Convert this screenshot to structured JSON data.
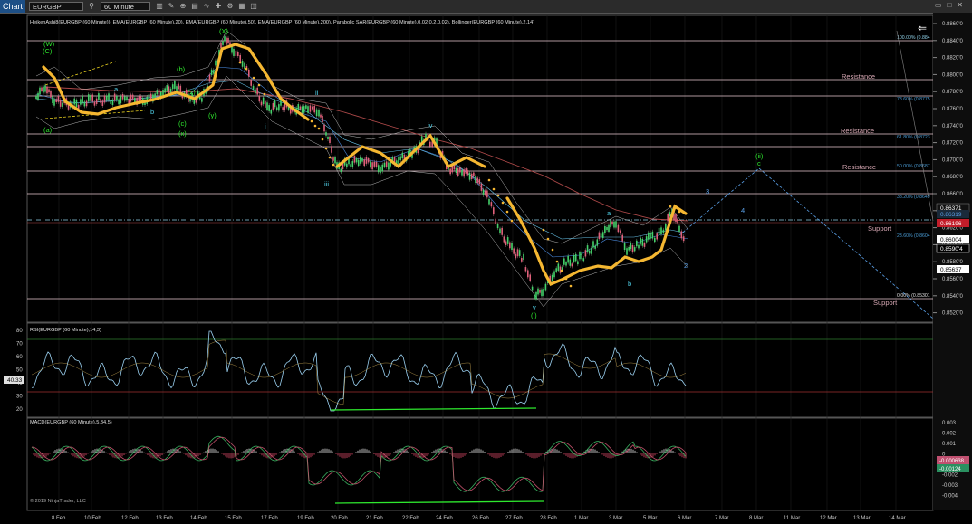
{
  "toolbar": {
    "chart_tab": "Chart",
    "instrument": "EURGBP",
    "interval": "60 Minute"
  },
  "panels": {
    "price_header": "HeikenAshi8(EURGBP (60 Minute)), EMA(EURGBP (60 Minute),20), EMA(EURGBP (60 Minute),50), EMA(EURGBP (60 Minute),200), Parabolic SAR(EURGBP (60 Minute),0.02,0.2,0.02), Bollinger(EURGBP (60 Minute),2,14)",
    "rsi_header": "RSI(EURGBP (60 Minute),14,3)",
    "macd_header": "MACD(EURGBP (60 Minute),5,34,5)",
    "copyright": "© 2019 NinjaTrader, LLC"
  },
  "price_axis": {
    "ticks": [
      "0.8860'0",
      "0.8840'0",
      "0.8820'0",
      "0.8800'0",
      "0.8780'0",
      "0.8760'0",
      "0.8740'0",
      "0.8720'0",
      "0.8700'0",
      "0.8680'0",
      "0.8660'0",
      "0.8640'0",
      "0.8620'0",
      "0.8600'0",
      "0.8580'0",
      "0.8560'0",
      "0.8540'0",
      "0.8520'0"
    ],
    "flags": {
      "last_price": "0.8590'4",
      "level_1": "0.86371",
      "level_2": "0.86319",
      "level_3": "0.86196",
      "level_4": "0.86004",
      "level_5": "0.85637"
    }
  },
  "rsi_axis": {
    "ticks": [
      "80",
      "70",
      "60",
      "50",
      "40",
      "30",
      "20"
    ],
    "current": "40.33"
  },
  "macd_axis": {
    "ticks": [
      "0.003",
      "0.002",
      "0.001",
      "0",
      "-0.001",
      "-0.002",
      "-0.003",
      "-0.004"
    ],
    "flag_1": "-0.000638",
    "flag_2": "-0.00124"
  },
  "x_axis": {
    "labels": [
      "8 Feb",
      "10 Feb",
      "12 Feb",
      "13 Feb",
      "14 Feb",
      "15 Feb",
      "17 Feb",
      "19 Feb",
      "20 Feb",
      "21 Feb",
      "22 Feb",
      "24 Feb",
      "26 Feb",
      "27 Feb",
      "28 Feb",
      "1 Mar",
      "3 Mar",
      "5 Mar",
      "6 Mar",
      "7 Mar",
      "8 Mar",
      "11 Mar",
      "12 Mar",
      "13 Mar",
      "14 Mar"
    ]
  },
  "annotations": {
    "resistance_1": "Resistance",
    "resistance_2": "Resistance",
    "resistance_3": "Resistance",
    "support_1": "Support",
    "support_2": "Support",
    "fib_100": "100.00% (0.884",
    "fib_786": "78.60% (0.8775",
    "fib_618": "61.80% (0.8723",
    "fib_50": "50.00% (0.8687",
    "fib_382": "38.20% (0.8649",
    "fib_236": "23.60% (0.8604",
    "fib_0": "0.00% (0.85301",
    "wave_W": "(W)",
    "wave_X_label": "(X)",
    "wave_ii": "(ii)",
    "wave_i": "(i)",
    "wave_c": "c",
    "wave_v": "v",
    "wave_iii": "iii",
    "wave_iv": "iv",
    "wave_a": "a",
    "wave_b": "b",
    "wave_3": "3",
    "wave_4": "4",
    "wave_2": "2",
    "wave_ii_small": "ii",
    "wave_i_small": "i",
    "wave_y": "(y)",
    "wave_z": "(z)",
    "wave_C": "(C)",
    "wave_a_paren": "(a)",
    "wave_b_paren": "(b)",
    "wave_c_paren": "(c)",
    "wave_x_paren": "(x)"
  },
  "colors": {
    "background": "#000000",
    "grid": "#3a3a3a",
    "ema_sar": "#f5b731",
    "heiken_up": "#44d26a",
    "heiken_down": "#e0607a",
    "ema200": "#b04a4a",
    "resistance_line": "#e8c8d0",
    "projection": "#5aa0e8",
    "rsi_line": "#9ad0f0",
    "divergence": "#2ee82e"
  }
}
